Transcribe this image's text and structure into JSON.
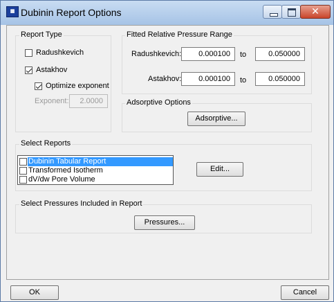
{
  "window": {
    "title": "Dubinin Report Options",
    "icon": "app-icon",
    "close_glyph": "✕"
  },
  "report_type": {
    "title": "Report Type",
    "radushkevich": {
      "label": "Radushkevich",
      "checked": false
    },
    "astakhov": {
      "label": "Astakhov",
      "checked": true
    },
    "optimize": {
      "label": "Optimize exponent",
      "checked": true
    },
    "exponent": {
      "label": "Exponent:",
      "value": "2.0000",
      "disabled": true
    }
  },
  "pressure_range": {
    "title": "Fitted Relative Pressure Range",
    "radushkevich": {
      "label": "Radushkevich:",
      "from": "0.000100",
      "to_label": "to",
      "to": "0.050000"
    },
    "astakhov": {
      "label": "Astakhov:",
      "from": "0.000100",
      "to_label": "to",
      "to": "0.050000"
    }
  },
  "adsorptive": {
    "title": "Adsorptive Options",
    "button": "Adsorptive..."
  },
  "select_reports": {
    "title": "Select Reports",
    "items": [
      {
        "label": "Dubinin Tabular Report",
        "checked": false,
        "selected": true
      },
      {
        "label": "Transformed Isotherm",
        "checked": false,
        "selected": false
      },
      {
        "label": "dV/dw Pore Volume",
        "checked": false,
        "selected": false
      }
    ],
    "edit_button": "Edit..."
  },
  "select_pressures": {
    "title": "Select Pressures Included in Report",
    "button": "Pressures..."
  },
  "footer": {
    "ok": "OK",
    "cancel": "Cancel"
  }
}
